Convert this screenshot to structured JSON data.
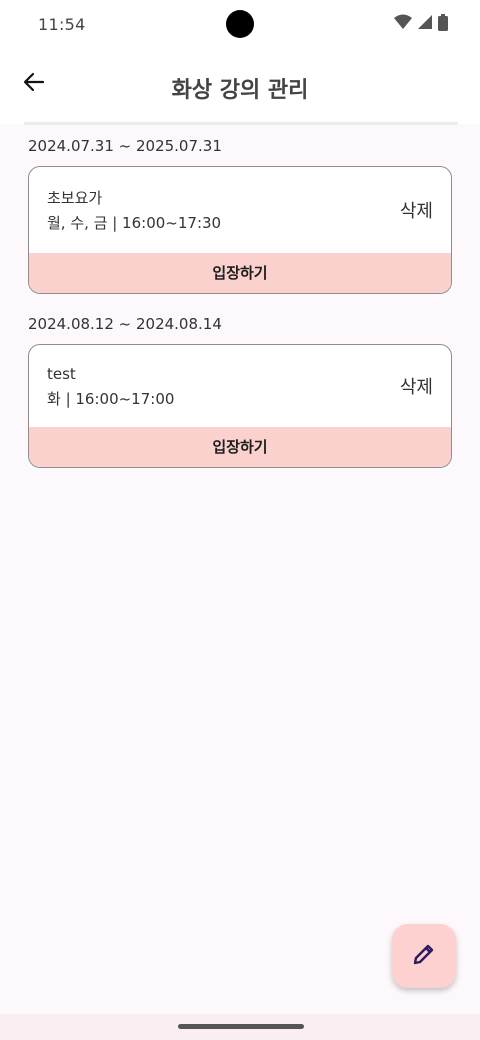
{
  "status_bar": {
    "time": "11:54",
    "icons": [
      "wifi-icon",
      "cell-signal-icon",
      "battery-icon"
    ]
  },
  "app_bar": {
    "back_icon": "arrow-left-icon",
    "title": "화상 강의 관리"
  },
  "lectures": [
    {
      "date_range": "2024.07.31 ~ 2025.07.31",
      "title": "초보요가",
      "schedule": "월, 수, 금 | 16:00~17:30",
      "delete_label": "삭제",
      "enter_label": "입장하기"
    },
    {
      "date_range": "2024.08.12 ~ 2024.08.14",
      "title": "test",
      "schedule": "화 | 16:00~17:00",
      "delete_label": "삭제",
      "enter_label": "입장하기"
    }
  ],
  "fab": {
    "icon": "pencil-icon"
  },
  "colors": {
    "accent": "#fbd1ce",
    "background": "#fdf8fb",
    "fab_icon": "#2a1a5e"
  }
}
